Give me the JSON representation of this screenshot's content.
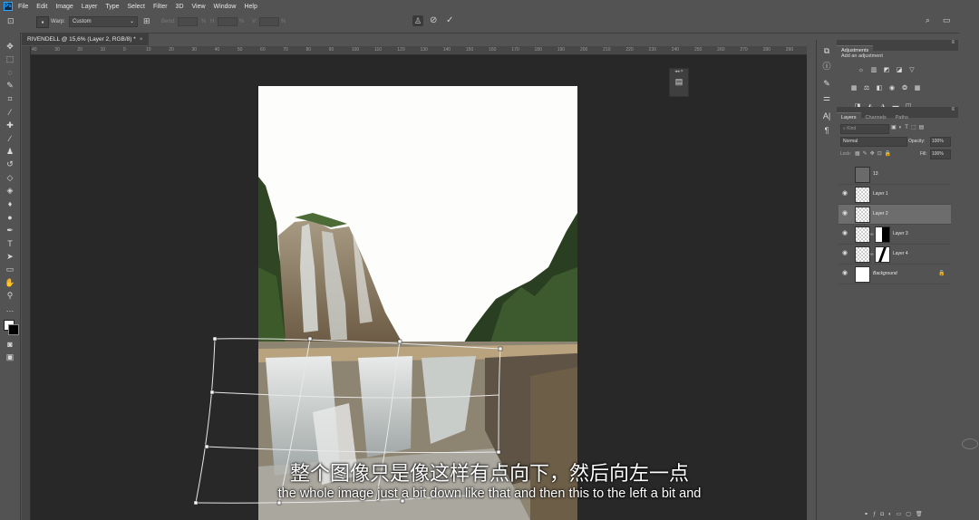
{
  "app": {
    "logo": "Ps"
  },
  "menu": [
    "File",
    "Edit",
    "Image",
    "Layer",
    "Type",
    "Select",
    "Filter",
    "3D",
    "View",
    "Window",
    "Help"
  ],
  "options": {
    "warp_label": "Warp:",
    "warp_value": "Custom",
    "bend_label": "Bend:",
    "h_label": "H:",
    "v_label": "V:",
    "pct": "%",
    "cancel_icon": "cancel-icon",
    "commit_icon": "checkmark-icon"
  },
  "document": {
    "tab_title": "RIVENDELL @ 15,6% (Layer 2, RGB/8) *",
    "close": "×"
  },
  "ruler": {
    "top_ticks": [
      "40",
      "30",
      "20",
      "10",
      "0",
      "10",
      "20",
      "30",
      "40",
      "50",
      "60",
      "70",
      "80",
      "90",
      "100",
      "110",
      "120",
      "130",
      "140",
      "150",
      "160",
      "170",
      "180",
      "190",
      "200",
      "210",
      "220",
      "230",
      "240",
      "250",
      "260",
      "270",
      "280",
      "290"
    ]
  },
  "adjustments": {
    "tab": "Adjustments",
    "heading": "Add an adjustment"
  },
  "layers_panel": {
    "tabs": [
      "Layers",
      "Channels",
      "Paths"
    ],
    "filter_placeholder": "Kind",
    "blend_mode": "Normal",
    "opacity_label": "Opacity:",
    "opacity_value": "100%",
    "lock_label": "Lock:",
    "fill_label": "Fill:",
    "fill_value": "100%",
    "layers": [
      {
        "name": "13",
        "visible": false,
        "selected": false
      },
      {
        "name": "Layer 1",
        "visible": true,
        "selected": false
      },
      {
        "name": "Layer 2",
        "visible": true,
        "selected": true
      },
      {
        "name": "Layer 3",
        "visible": true,
        "selected": false
      },
      {
        "name": "Layer 4",
        "visible": true,
        "selected": false
      },
      {
        "name": "Background",
        "visible": true,
        "selected": false
      }
    ]
  },
  "subtitles": {
    "chinese": "整个图像只是像这样有点向下，然后向左一点",
    "english": "the whole image just a bit down like that and then this to the left a bit and"
  }
}
